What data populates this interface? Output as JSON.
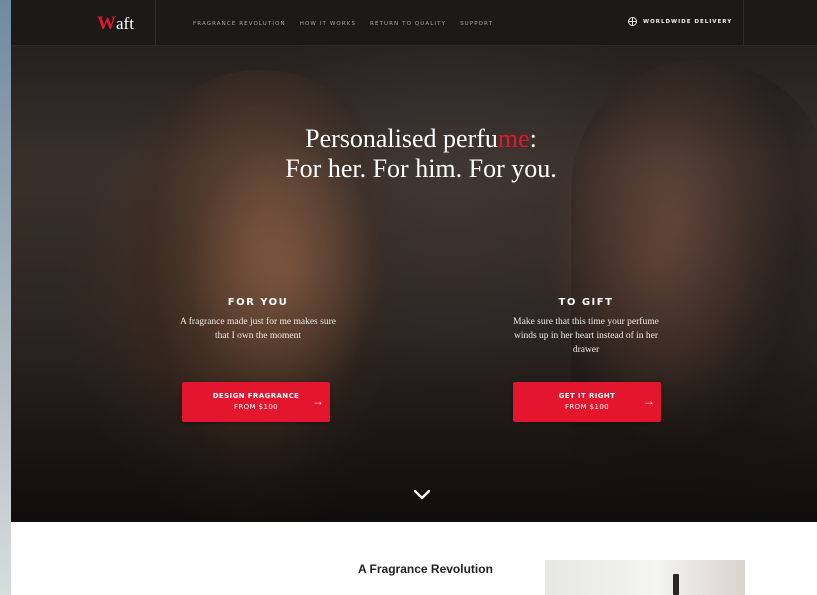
{
  "nav": {
    "logo_w": "W",
    "logo_rest": "aft",
    "links": [
      "FRAGRANCE REVOLUTION",
      "HOW IT WORKS",
      "RETURN TO QUALITY",
      "SUPPORT"
    ],
    "delivery": "WORLDWIDE DELIVERY",
    "delivery_icon": "globe-icon"
  },
  "hero": {
    "headline_part1": "Personalised perfu",
    "headline_red": "me",
    "headline_part2": ":",
    "headline_line2": "For her. For him. For you.",
    "accent_color": "#e3162d",
    "left": {
      "title": "FOR YOU",
      "text": "A fragrance made just for me makes sure that I own the moment",
      "cta_main": "DESIGN FRAGRANCE",
      "cta_sub": "FROM $100"
    },
    "right": {
      "title": "TO GIFT",
      "text": "Make sure that this time your perfume winds up in her heart instead of in her drawer",
      "cta_main": "GET IT RIGHT",
      "cta_sub": "FROM $100"
    },
    "scroll_icon": "chevron-down-icon"
  },
  "section": {
    "title": "A Fragrance Revolution"
  }
}
